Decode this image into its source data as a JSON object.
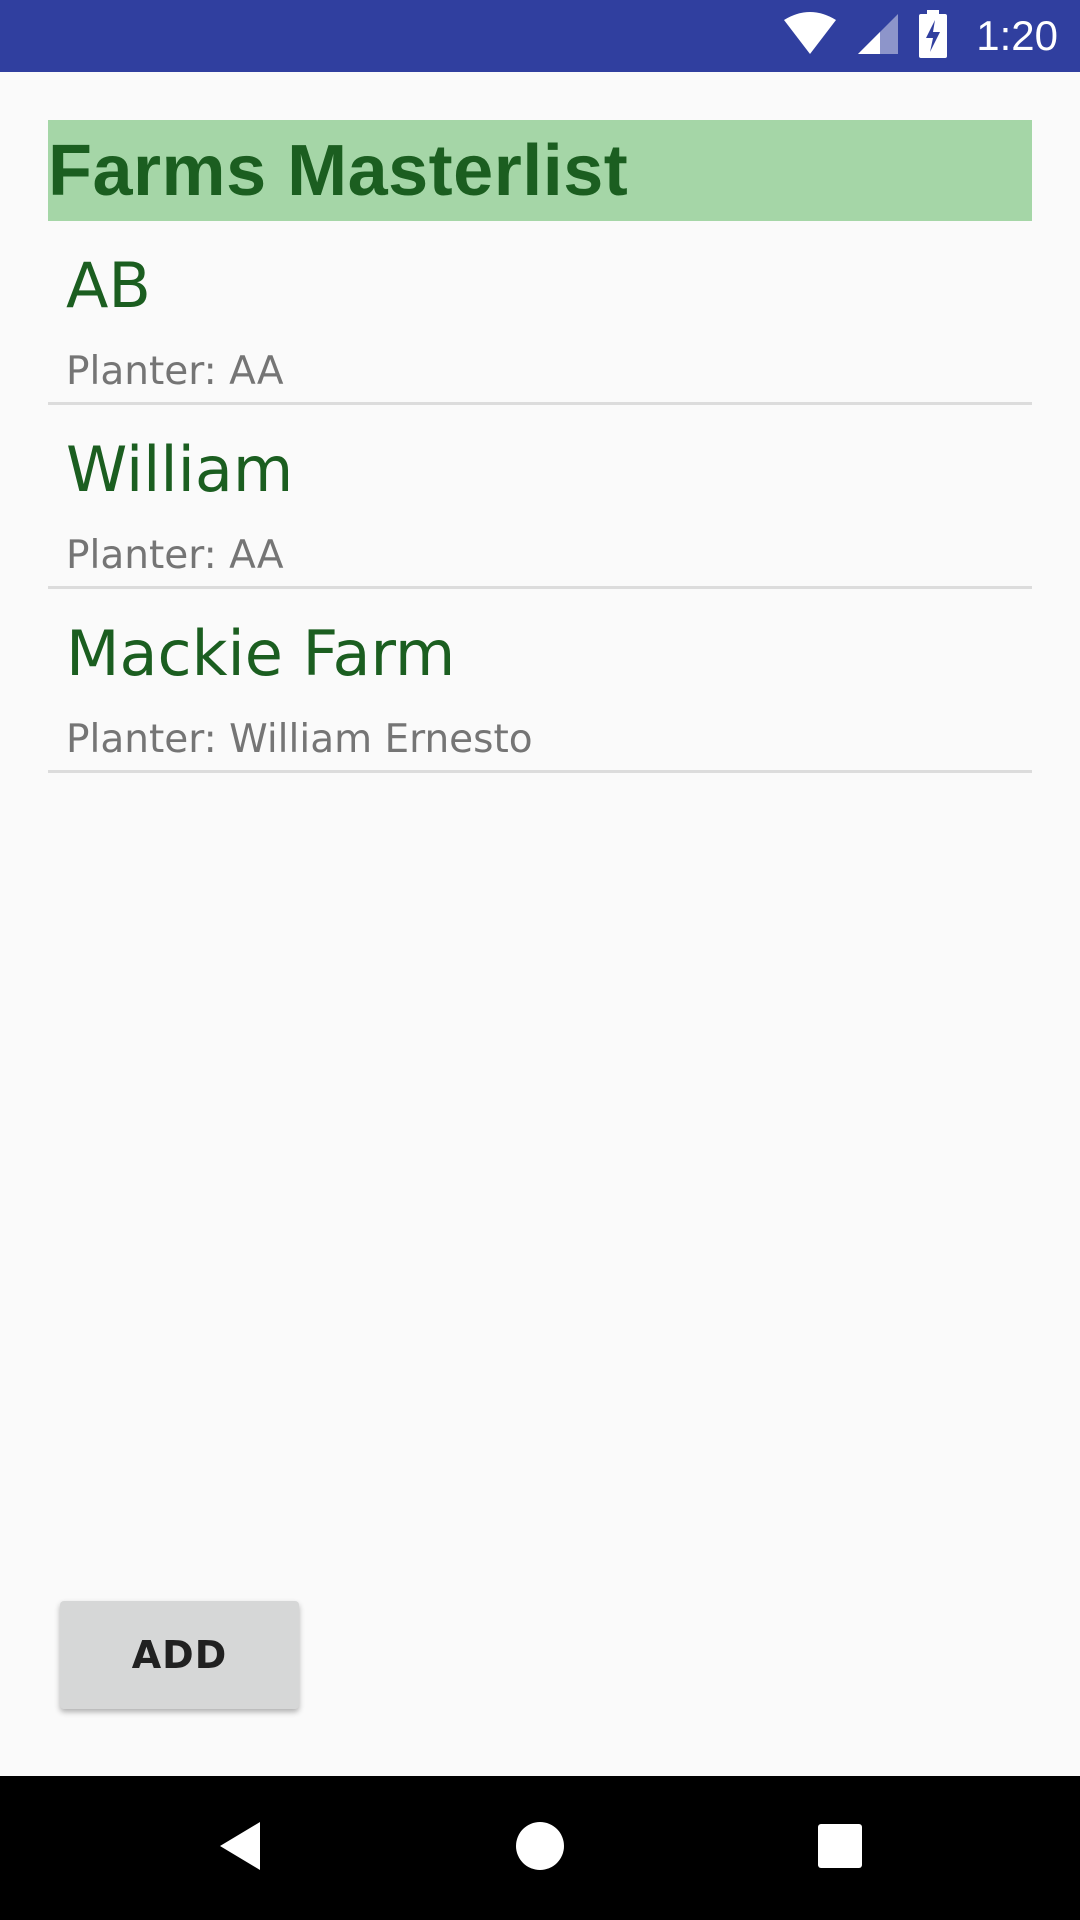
{
  "status_bar": {
    "time": "1:20",
    "icons": [
      "wifi-icon",
      "cell-signal-icon",
      "battery-charging-icon"
    ],
    "background": "#303f9f"
  },
  "page": {
    "title": "Farms Masterlist",
    "title_color": "#1b5e20",
    "title_background": "#a5d6a7"
  },
  "farms": [
    {
      "name": "AB",
      "planter": "Planter: AA"
    },
    {
      "name": "William",
      "planter": "Planter: AA"
    },
    {
      "name": "Mackie Farm",
      "planter": "Planter: William Ernesto"
    }
  ],
  "actions": {
    "add_label": "ADD"
  },
  "nav_bar": {
    "buttons": [
      "back-icon",
      "home-icon",
      "recents-icon"
    ]
  }
}
